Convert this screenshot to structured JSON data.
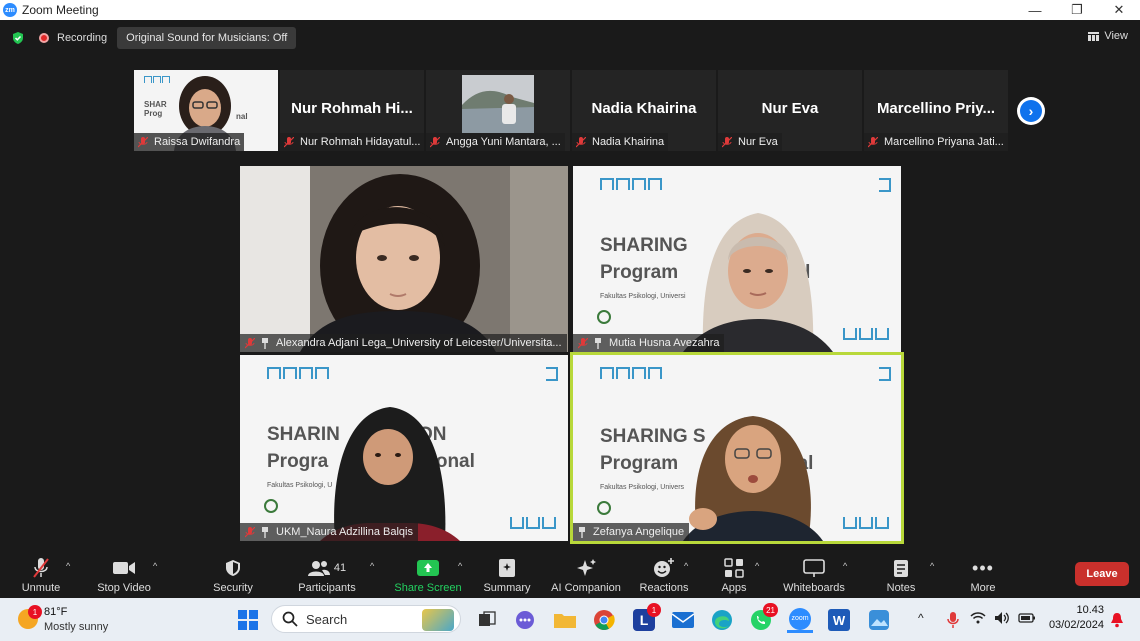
{
  "window": {
    "title": "Zoom Meeting",
    "app_icon_text": "zm",
    "minimize": "—",
    "restore": "❐",
    "close": "✕"
  },
  "top_bar": {
    "recording_label": "Recording",
    "original_sound_label": "Original Sound for Musicians: Off",
    "view_label": "View"
  },
  "strip": {
    "tiles": [
      {
        "big_name": "",
        "label": "Raissa Dwifandra",
        "has_video": true
      },
      {
        "big_name": "Nur Rohmah Hi...",
        "label": "Nur Rohmah Hidayatul...",
        "has_video": false
      },
      {
        "big_name": "",
        "label": "Angga Yuni Mantara, ...",
        "has_video": true
      },
      {
        "big_name": "Nadia Khairina",
        "label": "Nadia Khairina",
        "has_video": false
      },
      {
        "big_name": "Nur Eva",
        "label": "Nur Eva",
        "has_video": false
      },
      {
        "big_name": "Marcellino Priy...",
        "label": "Marcellino Priyana Jati...",
        "has_video": false
      }
    ]
  },
  "gallery": {
    "tiles": [
      {
        "label": "Alexandra Adjani Lega_University of Leicester/Universita..."
      },
      {
        "label": "Mutia Husna Avezahra",
        "slide_line1": "SHARING",
        "slide_line2": "Program",
        "slide_line2b": "nal",
        "slide_small": "Fakultas Psikologi, Universi"
      },
      {
        "label": "UKM_Naura Adzillina Balqis",
        "slide_line1": "SHARIN",
        "slide_line1b": "ON",
        "slide_line2": "Progra",
        "slide_line2b": "sional",
        "slide_small": "Fakultas Psikologi, U"
      },
      {
        "label": "Zefanya Angelique",
        "slide_line1": "SHARING S",
        "slide_line2": "Program",
        "slide_line2b": "nal",
        "slide_small": "Fakultas Psikologi, Univers"
      }
    ]
  },
  "toolbar": {
    "unmute": "Unmute",
    "stop_video": "Stop Video",
    "security": "Security",
    "participants": "Participants",
    "participants_count": "41",
    "share_screen": "Share Screen",
    "summary": "Summary",
    "ai_companion": "AI Companion",
    "reactions": "Reactions",
    "apps": "Apps",
    "whiteboards": "Whiteboards",
    "notes": "Notes",
    "more": "More",
    "leave": "Leave",
    "caret": "^"
  },
  "taskbar": {
    "weather_temp": "81°F",
    "weather_desc": "Mostly sunny",
    "weather_badge": "1",
    "search_label": "Search",
    "badge_l": "1",
    "badge_whatsapp": "21",
    "time": "10.43",
    "date": "03/02/2024",
    "chevron": "^"
  }
}
